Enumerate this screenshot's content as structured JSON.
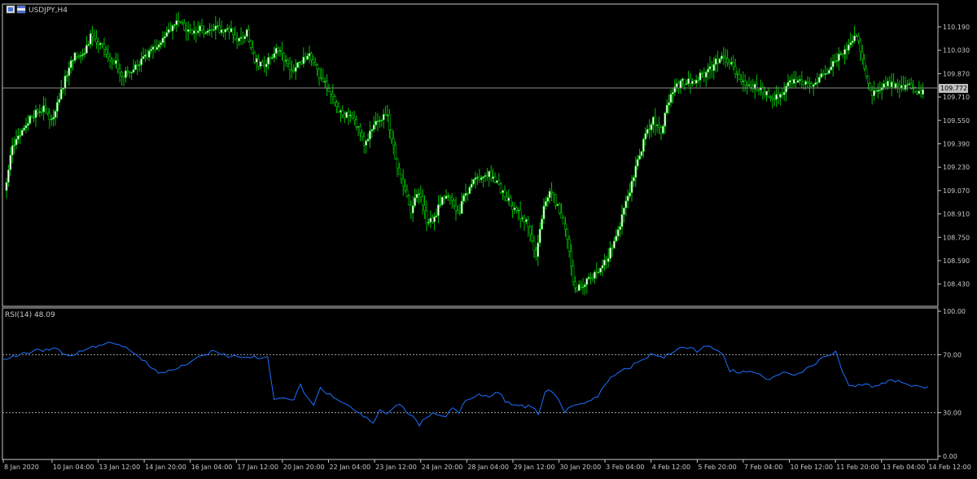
{
  "window": {
    "symbol_title": "USDJPY,H4"
  },
  "colors": {
    "background": "#000000",
    "frame": "#c8c8c8",
    "candle": "#00c000",
    "bull_body": "#ffffff",
    "bear_body": "#000000",
    "price_line": "#8c8c8c",
    "rsi_line": "#1e6fff",
    "level_line": "#a0a0a0",
    "text": "#c8c8c8"
  },
  "chart_data": [
    {
      "type": "candlestick",
      "title": "USDJPY,H4",
      "ylim": [
        108.27,
        110.3
      ],
      "price_ticks": [
        "110.190",
        "110.030",
        "109.870",
        "109.710",
        "109.550",
        "109.390",
        "109.230",
        "109.070",
        "108.910",
        "108.750",
        "108.590",
        "108.430"
      ],
      "current_price": "109.772",
      "anchors": [
        [
          0,
          109.07
        ],
        [
          4,
          109.36
        ],
        [
          8,
          109.46
        ],
        [
          12,
          109.54
        ],
        [
          16,
          109.61
        ],
        [
          20,
          109.63
        ],
        [
          24,
          109.54
        ],
        [
          28,
          109.7
        ],
        [
          32,
          109.88
        ],
        [
          36,
          109.99
        ],
        [
          40,
          110.0
        ],
        [
          44,
          110.12
        ],
        [
          48,
          110.08
        ],
        [
          52,
          110.02
        ],
        [
          56,
          109.96
        ],
        [
          60,
          109.86
        ],
        [
          64,
          109.87
        ],
        [
          68,
          109.92
        ],
        [
          72,
          109.98
        ],
        [
          76,
          110.03
        ],
        [
          80,
          110.08
        ],
        [
          84,
          110.17
        ],
        [
          88,
          110.21
        ],
        [
          92,
          110.19
        ],
        [
          96,
          110.14
        ],
        [
          100,
          110.18
        ],
        [
          104,
          110.14
        ],
        [
          108,
          110.18
        ],
        [
          112,
          110.17
        ],
        [
          116,
          110.16
        ],
        [
          120,
          110.09
        ],
        [
          124,
          110.16
        ],
        [
          128,
          109.96
        ],
        [
          132,
          109.92
        ],
        [
          136,
          109.97
        ],
        [
          140,
          110.05
        ],
        [
          144,
          109.94
        ],
        [
          148,
          109.9
        ],
        [
          152,
          109.96
        ],
        [
          156,
          110.0
        ],
        [
          160,
          109.88
        ],
        [
          164,
          109.82
        ],
        [
          168,
          109.7
        ],
        [
          172,
          109.6
        ],
        [
          176,
          109.58
        ],
        [
          180,
          109.52
        ],
        [
          184,
          109.4
        ],
        [
          188,
          109.48
        ],
        [
          192,
          109.56
        ],
        [
          196,
          109.58
        ],
        [
          200,
          109.29
        ],
        [
          204,
          109.09
        ],
        [
          208,
          108.93
        ],
        [
          212,
          109.06
        ],
        [
          216,
          108.86
        ],
        [
          220,
          108.88
        ],
        [
          224,
          109.02
        ],
        [
          228,
          109.04
        ],
        [
          232,
          108.9
        ],
        [
          236,
          109.05
        ],
        [
          240,
          109.13
        ],
        [
          244,
          109.18
        ],
        [
          248,
          109.18
        ],
        [
          252,
          109.13
        ],
        [
          256,
          109.03
        ],
        [
          260,
          108.96
        ],
        [
          264,
          108.9
        ],
        [
          268,
          108.84
        ],
        [
          272,
          108.62
        ],
        [
          276,
          108.98
        ],
        [
          280,
          109.06
        ],
        [
          284,
          108.92
        ],
        [
          288,
          108.74
        ],
        [
          292,
          108.38
        ],
        [
          296,
          108.43
        ],
        [
          300,
          108.47
        ],
        [
          304,
          108.52
        ],
        [
          308,
          108.6
        ],
        [
          312,
          108.71
        ],
        [
          316,
          108.89
        ],
        [
          320,
          109.08
        ],
        [
          324,
          109.26
        ],
        [
          328,
          109.46
        ],
        [
          332,
          109.56
        ],
        [
          336,
          109.48
        ],
        [
          340,
          109.69
        ],
        [
          344,
          109.78
        ],
        [
          348,
          109.82
        ],
        [
          352,
          109.81
        ],
        [
          356,
          109.86
        ],
        [
          360,
          109.88
        ],
        [
          364,
          109.95
        ],
        [
          368,
          109.98
        ],
        [
          372,
          109.93
        ],
        [
          376,
          109.82
        ],
        [
          380,
          109.78
        ],
        [
          384,
          109.79
        ],
        [
          388,
          109.75
        ],
        [
          392,
          109.7
        ],
        [
          396,
          109.72
        ],
        [
          400,
          109.78
        ],
        [
          404,
          109.82
        ],
        [
          408,
          109.81
        ],
        [
          412,
          109.79
        ],
        [
          416,
          109.83
        ],
        [
          420,
          109.87
        ],
        [
          424,
          109.94
        ],
        [
          428,
          110.0
        ],
        [
          432,
          110.05
        ],
        [
          436,
          110.14
        ],
        [
          440,
          109.91
        ],
        [
          444,
          109.72
        ],
        [
          448,
          109.76
        ],
        [
          452,
          109.8
        ],
        [
          456,
          109.78
        ],
        [
          460,
          109.77
        ],
        [
          464,
          109.78
        ],
        [
          468,
          109.74
        ]
      ],
      "x_ticks": [
        {
          "label": "8 Jan 2020",
          "at": 0
        },
        {
          "label": "10 Jan 04:00",
          "at": 18
        },
        {
          "label": "13 Jan 12:00",
          "at": 35
        },
        {
          "label": "14 Jan 20:00",
          "at": 52
        },
        {
          "label": "16 Jan 04:00",
          "at": 69
        },
        {
          "label": "17 Jan 12:00",
          "at": 86
        },
        {
          "label": "20 Jan 20:00",
          "at": 103
        },
        {
          "label": "22 Jan 04:00",
          "at": 120
        },
        {
          "label": "23 Jan 12:00",
          "at": 137
        },
        {
          "label": "24 Jan 20:00",
          "at": 154
        },
        {
          "label": "28 Jan 04:00",
          "at": 171
        },
        {
          "label": "29 Jan 12:00",
          "at": 188
        },
        {
          "label": "30 Jan 20:00",
          "at": 205
        },
        {
          "label": "3 Feb 04:00",
          "at": 222
        },
        {
          "label": "4 Feb 12:00",
          "at": 239
        },
        {
          "label": "5 Feb 20:00",
          "at": 256
        },
        {
          "label": "7 Feb 04:00",
          "at": 273
        },
        {
          "label": "10 Feb 12:00",
          "at": 290
        },
        {
          "label": "11 Feb 20:00",
          "at": 307
        },
        {
          "label": "13 Feb 04:00",
          "at": 324
        },
        {
          "label": "14 Feb 12:00",
          "at": 341
        }
      ]
    },
    {
      "type": "line",
      "title": "RSI(14) 48.09",
      "series": [
        {
          "name": "RSI(14)",
          "last_value": 48.09
        }
      ],
      "ylim": [
        0,
        100
      ],
      "ticks": [
        "100.00",
        "70.00",
        "30.00",
        "0.00"
      ],
      "levels": [
        70,
        30
      ],
      "anchors": [
        [
          0,
          66
        ],
        [
          4,
          69
        ],
        [
          8,
          72
        ],
        [
          12,
          73
        ],
        [
          16,
          74
        ],
        [
          18,
          70
        ],
        [
          20,
          69
        ],
        [
          24,
          73
        ],
        [
          28,
          76
        ],
        [
          32,
          78
        ],
        [
          36,
          76
        ],
        [
          40,
          71
        ],
        [
          44,
          63
        ],
        [
          48,
          57
        ],
        [
          52,
          60
        ],
        [
          56,
          64
        ],
        [
          60,
          69
        ],
        [
          64,
          73
        ],
        [
          68,
          69
        ],
        [
          72,
          68
        ],
        [
          76,
          68
        ],
        [
          80,
          68
        ],
        [
          82,
          38
        ],
        [
          84,
          40
        ],
        [
          88,
          39
        ],
        [
          90,
          50
        ],
        [
          92,
          40
        ],
        [
          94,
          36
        ],
        [
          96,
          48
        ],
        [
          98,
          44
        ],
        [
          100,
          41
        ],
        [
          104,
          35
        ],
        [
          108,
          29
        ],
        [
          110,
          27
        ],
        [
          112,
          22
        ],
        [
          114,
          32
        ],
        [
          116,
          29
        ],
        [
          118,
          33
        ],
        [
          120,
          35
        ],
        [
          122,
          31
        ],
        [
          124,
          27
        ],
        [
          126,
          22
        ],
        [
          128,
          26
        ],
        [
          130,
          29
        ],
        [
          132,
          29
        ],
        [
          134,
          28
        ],
        [
          136,
          34
        ],
        [
          138,
          30
        ],
        [
          140,
          39
        ],
        [
          144,
          42
        ],
        [
          148,
          41
        ],
        [
          150,
          45
        ],
        [
          152,
          38
        ],
        [
          156,
          35
        ],
        [
          160,
          34
        ],
        [
          162,
          30
        ],
        [
          164,
          44
        ],
        [
          166,
          45
        ],
        [
          168,
          40
        ],
        [
          170,
          30
        ],
        [
          172,
          35
        ],
        [
          176,
          37
        ],
        [
          180,
          42
        ],
        [
          184,
          55
        ],
        [
          188,
          60
        ],
        [
          192,
          64
        ],
        [
          196,
          70
        ],
        [
          200,
          68
        ],
        [
          204,
          74
        ],
        [
          208,
          76
        ],
        [
          210,
          71
        ],
        [
          212,
          75
        ],
        [
          214,
          76
        ],
        [
          216,
          72
        ],
        [
          218,
          69
        ],
        [
          220,
          59
        ],
        [
          224,
          58
        ],
        [
          228,
          57
        ],
        [
          232,
          52
        ],
        [
          236,
          59
        ],
        [
          240,
          55
        ],
        [
          244,
          61
        ],
        [
          248,
          68
        ],
        [
          252,
          72
        ],
        [
          254,
          59
        ],
        [
          256,
          48
        ],
        [
          260,
          49
        ],
        [
          264,
          48
        ],
        [
          268,
          52
        ],
        [
          272,
          52
        ],
        [
          276,
          48
        ]
      ]
    }
  ]
}
